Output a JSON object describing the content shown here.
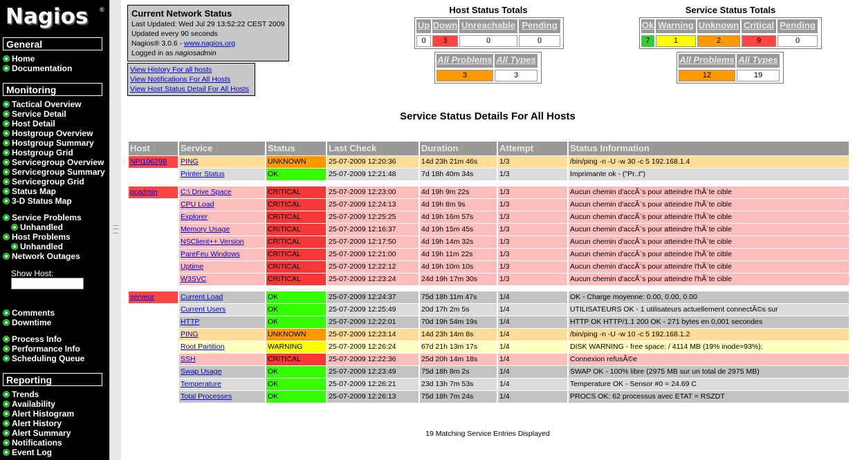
{
  "nav": {
    "logo": "Nagios",
    "logo_mark": "®",
    "general": {
      "title": "General",
      "items": [
        "Home",
        "Documentation"
      ]
    },
    "monitoring": {
      "title": "Monitoring",
      "items": [
        "Tactical Overview",
        "Service Detail",
        "Host Detail",
        "Hostgroup Overview",
        "Hostgroup Summary",
        "Hostgroup Grid",
        "Servicegroup Overview",
        "Servicegroup Summary",
        "Servicegroup Grid",
        "Status Map",
        "3-D Status Map"
      ]
    },
    "problems": [
      "Service Problems",
      "Unhandled",
      "Host Problems",
      "Unhandled",
      "Network Outages"
    ],
    "show_host_label": "Show Host:",
    "misc1": [
      "Comments",
      "Downtime"
    ],
    "misc2": [
      "Process Info",
      "Performance Info",
      "Scheduling Queue"
    ],
    "reporting": {
      "title": "Reporting",
      "items": [
        "Trends",
        "Availability",
        "Alert Histogram",
        "Alert History",
        "Alert Summary",
        "Notifications",
        "Event Log"
      ]
    }
  },
  "info": {
    "title": "Current Network Status",
    "last_updated": "Last Updated: Wed Jul 29 13:52:22 CEST 2009",
    "update_every": "Updated every 90 seconds",
    "version_prefix": "Nagios® 3.0.6 - ",
    "version_link": "www.nagios.org",
    "logged_prefix": "Logged in as ",
    "user": "nagiosadmin",
    "links": [
      "View History For all hosts",
      "View Notifications For All Hosts",
      "View Host Status Detail For All Hosts"
    ]
  },
  "host_totals": {
    "title": "Host Status Totals",
    "headers": [
      "Up",
      "Down",
      "Unreachable",
      "Pending"
    ],
    "values": [
      "0",
      "3",
      "0",
      "0"
    ],
    "colors": [
      "#ffffff",
      "#ff4444",
      "#ffffff",
      "#ffffff"
    ],
    "problem_headers": [
      "All Problems",
      "All Types"
    ],
    "problem_values": [
      "3",
      "3"
    ]
  },
  "service_totals": {
    "title": "Service Status Totals",
    "headers": [
      "Ok",
      "Warning",
      "Unknown",
      "Critical",
      "Pending"
    ],
    "values": [
      "7",
      "1",
      "2",
      "9",
      "0"
    ],
    "colors": [
      "#33cc33",
      "#ffff00",
      "#ff9900",
      "#ff4444",
      "#ffffff"
    ],
    "problem_headers": [
      "All Problems",
      "All Types"
    ],
    "problem_values": [
      "12",
      "19"
    ]
  },
  "main_title": "Service Status Details For All Hosts",
  "columns": [
    "Host",
    "Service",
    "Status",
    "Last Check",
    "Duration",
    "Attempt",
    "Status Information"
  ],
  "rows": [
    {
      "host": "NPI10629B",
      "service": "PING",
      "status": "UNKNOWN",
      "check": "25-07-2009 12:20:36",
      "duration": "14d 23h 21m 46s",
      "attempt": "1/3",
      "info": "/bin/ping -n -U -w 30 -c 5 192.168.1.4"
    },
    {
      "host": "",
      "service": "Printer Status",
      "status": "OK",
      "check": "25-07-2009 12:21:48",
      "duration": "7d 18h 40m 34s",
      "attempt": "1/3",
      "info": "Imprimante ok - (\"Pr..t\")"
    },
    {
      "host": "pcadmin",
      "service": "C:\\ Drive Space",
      "status": "CRITICAL",
      "check": "25-07-2009 12:23:00",
      "duration": "4d 19h 9m 22s",
      "attempt": "1/3",
      "info": "Aucun chemin d'accÃ¨s pour atteindre l'hÃ´te cible"
    },
    {
      "host": "",
      "service": "CPU Load",
      "status": "CRITICAL",
      "check": "25-07-2009 12:24:13",
      "duration": "4d 19h 8m 9s",
      "attempt": "1/3",
      "info": "Aucun chemin d'accÃ¨s pour atteindre l'hÃ´te cible"
    },
    {
      "host": "",
      "service": "Explorer",
      "status": "CRITICAL",
      "check": "25-07-2009 12:25:25",
      "duration": "4d 19h 16m 57s",
      "attempt": "1/3",
      "info": "Aucun chemin d'accÃ¨s pour atteindre l'hÃ´te cible"
    },
    {
      "host": "",
      "service": "Memory Usage",
      "status": "CRITICAL",
      "check": "25-07-2009 12:16:37",
      "duration": "4d 19h 15m 45s",
      "attempt": "1/3",
      "info": "Aucun chemin d'accÃ¨s pour atteindre l'hÃ´te cible"
    },
    {
      "host": "",
      "service": "NSClient++ Version",
      "status": "CRITICAL",
      "check": "25-07-2009 12:17:50",
      "duration": "4d 19h 14m 32s",
      "attempt": "1/3",
      "info": "Aucun chemin d'accÃ¨s pour atteindre l'hÃ´te cible"
    },
    {
      "host": "",
      "service": "PareFeu Windows",
      "status": "CRITICAL",
      "check": "25-07-2009 12:21:00",
      "duration": "4d 19h 11m 22s",
      "attempt": "1/3",
      "info": "Aucun chemin d'accÃ¨s pour atteindre l'hÃ´te cible"
    },
    {
      "host": "",
      "service": "Uptime",
      "status": "CRITICAL",
      "check": "25-07-2009 12:22:12",
      "duration": "4d 19h 10m 10s",
      "attempt": "1/3",
      "info": "Aucun chemin d'accÃ¨s pour atteindre l'hÃ´te cible"
    },
    {
      "host": "",
      "service": "W3SVC",
      "status": "CRITICAL",
      "check": "25-07-2009 12:23:24",
      "duration": "24d 19h 17m 30s",
      "attempt": "1/3",
      "info": "Aucun chemin d'accÃ¨s pour atteindre l'hÃ´te cible"
    },
    {
      "host": "serveur",
      "service": "Current Load",
      "status": "OK",
      "check": "25-07-2009 12:24:37",
      "duration": "75d 18h 11m 47s",
      "attempt": "1/4",
      "info": "OK - Charge moyenne: 0.00, 0.00, 0.00"
    },
    {
      "host": "",
      "service": "Current Users",
      "status": "OK",
      "check": "25-07-2009 12:25:49",
      "duration": "20d 17h 2m 5s",
      "attempt": "1/4",
      "info": "UTILISATEURS OK - 1 utilisateurs actuellement connectÃ©s sur"
    },
    {
      "host": "",
      "service": "HTTP",
      "status": "OK",
      "check": "25-07-2009 12:22:01",
      "duration": "70d 19h 54m 19s",
      "attempt": "1/4",
      "info": "HTTP OK HTTP/1.1 200 OK - 271 bytes en 0,001 secondes"
    },
    {
      "host": "",
      "service": "PING",
      "status": "UNKNOWN",
      "check": "25-07-2009 12:23:14",
      "duration": "14d 23h 14m 8s",
      "attempt": "1/4",
      "info": "/bin/ping -n -U -w 10 -c 5 192.168.1.2"
    },
    {
      "host": "",
      "service": "Root Partition",
      "status": "WARNING",
      "check": "25-07-2009 12:26:24",
      "duration": "67d 21h 13m 17s",
      "attempt": "1/4",
      "info": "DISK WARNING - free space: / 4114 MB (19% inode=93%):"
    },
    {
      "host": "",
      "service": "SSH",
      "status": "CRITICAL",
      "check": "25-07-2009 12:22:36",
      "duration": "25d 20h 14m 18s",
      "attempt": "1/4",
      "info": "Connexion refusÃ©e"
    },
    {
      "host": "",
      "service": "Swap Usage",
      "status": "OK",
      "check": "25-07-2009 12:23:49",
      "duration": "75d 18h 8m 2s",
      "attempt": "1/4",
      "info": "SWAP OK - 100% libre (2975 MB sur un total de 2975 MB)"
    },
    {
      "host": "",
      "service": "Temperature",
      "status": "OK",
      "check": "25-07-2009 12:26:21",
      "duration": "23d 13h 7m 53s",
      "attempt": "1/4",
      "info": "Temperature OK - Sensor #0 = 24.69 C"
    },
    {
      "host": "",
      "service": "Total Processes",
      "status": "OK",
      "check": "25-07-2009 12:26:13",
      "duration": "75d 18h 7m 24s",
      "attempt": "1/4",
      "info": "PROCS OK: 62 processus avec ETAT = RSZDT"
    }
  ],
  "footer": "19 Matching Service Entries Displayed",
  "status_colors": {
    "OK": "#33ff00",
    "UNKNOWN": "#ff9900",
    "CRITICAL": "#f83838",
    "WARNING": "#ffff00"
  },
  "row_colors": {
    "OK": [
      "#dbdbdb",
      "#c3c3c3"
    ],
    "UNKNOWN": "#ffdd99",
    "CRITICAL": "#febdbd",
    "WARNING": "#feffc1"
  }
}
